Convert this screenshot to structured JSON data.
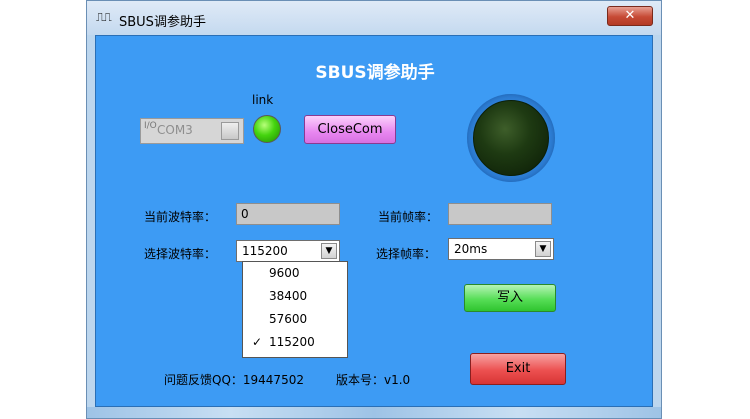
{
  "window": {
    "title": "SBUS调参助手",
    "title_icon": "⎍⎍",
    "close_glyph": "✕"
  },
  "app": {
    "heading": "SBUS调参助手",
    "link_label": "link",
    "link_status": "connected",
    "com_port": {
      "icon": "I/O",
      "value": "COM3"
    },
    "close_com_label": "CloseCom",
    "indicator_state": "off"
  },
  "form": {
    "current_baud_label": "当前波特率：",
    "current_baud_value": "0",
    "current_frame_label": "当前帧率：",
    "current_frame_value": "",
    "select_baud_label": "选择波特率：",
    "select_baud_value": "115200",
    "select_frame_label": "选择帧率：",
    "select_frame_value": "20ms",
    "baud_options": [
      "9600",
      "38400",
      "57600",
      "115200"
    ],
    "baud_checked_mark": "✓",
    "write_label": "写入",
    "exit_label": "Exit"
  },
  "footer": {
    "qq": "问题反馈QQ：19447502",
    "version": "版本号：v1.0"
  },
  "colors": {
    "client_bg": "#3d9bf4",
    "close_com_button": "#e887f0",
    "write_button": "#57de57",
    "exit_button": "#ec5050",
    "link_led": "#44d40e",
    "indicator_led": "#1e3a12"
  }
}
